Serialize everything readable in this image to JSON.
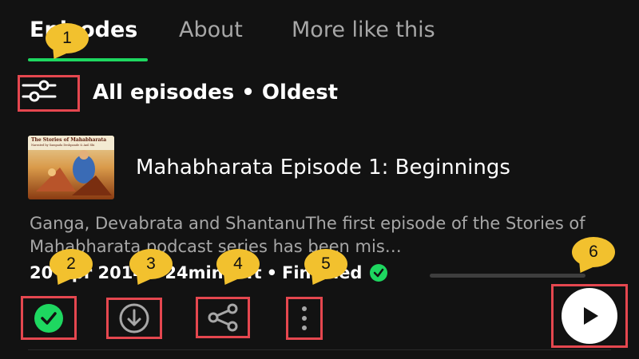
{
  "tabs": [
    {
      "label": "Episodes",
      "active": true
    },
    {
      "label": "About",
      "active": false
    },
    {
      "label": "More like this",
      "active": false
    }
  ],
  "filter": {
    "label": "All episodes • Oldest",
    "icon": "filter-sliders-icon"
  },
  "episode": {
    "thumbnail_title": "The Stories of Mahabharata",
    "thumbnail_subtitle": "Narrated by Sampada Deshpande & Anil Shi",
    "title": "Mahabharata Episode 1: Beginnings",
    "description": "Ganga, Devabrata and ShantanuThe first episode of the Stories of Mahabharata podcast series has been mis…",
    "date": "20 Apr 2014",
    "duration": "24min left",
    "status": "Finished",
    "progress_fraction": 0.0
  },
  "actions": {
    "mark_played_icon": "check-circle-icon",
    "download_icon": "download-icon",
    "share_icon": "share-icon",
    "more_icon": "more-vertical-icon",
    "play_icon": "play-icon"
  },
  "annotations": [
    "1",
    "2",
    "3",
    "4",
    "5",
    "6"
  ],
  "colors": {
    "background": "#121212",
    "accent_green": "#1ed760",
    "highlight_red": "#e5474f",
    "bubble_yellow": "#f2c12e",
    "muted_text": "#a7a7a7"
  }
}
